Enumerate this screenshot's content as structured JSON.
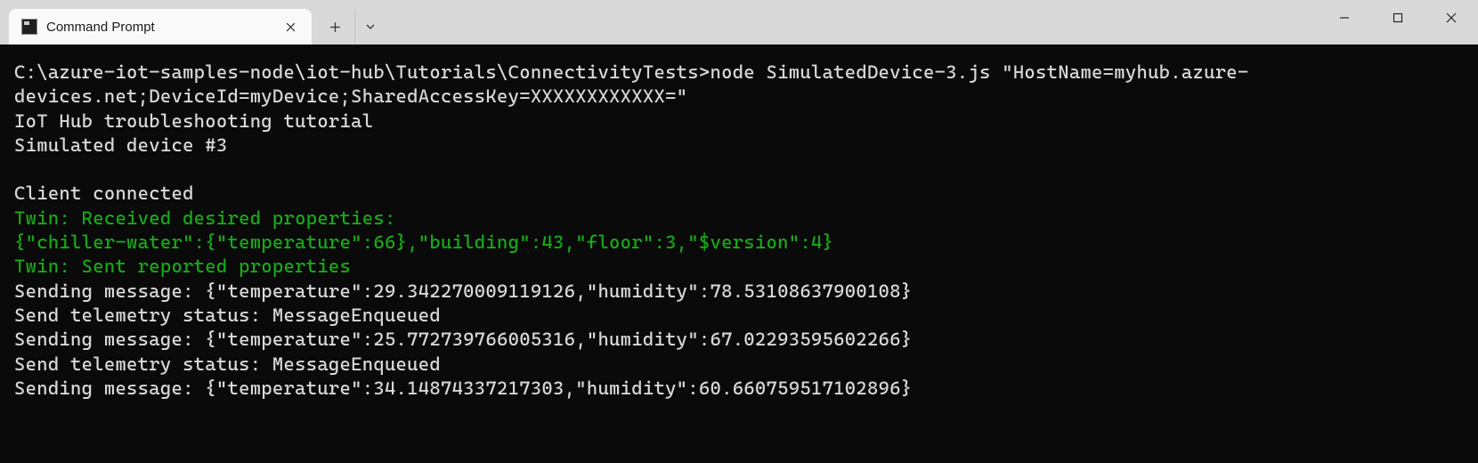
{
  "tab": {
    "title": "Command Prompt"
  },
  "terminal": {
    "lines": [
      {
        "text": "C:\\azure-iot-samples-node\\iot-hub\\Tutorials\\ConnectivityTests>node SimulatedDevice-3.js \"HostName=myhub.azure-devices.net;DeviceId=myDevice;SharedAccessKey=XXXXXXXXXXXX=\"",
        "class": ""
      },
      {
        "text": "IoT Hub troubleshooting tutorial",
        "class": ""
      },
      {
        "text": "Simulated device #3",
        "class": ""
      },
      {
        "text": "",
        "class": ""
      },
      {
        "text": "Client connected",
        "class": ""
      },
      {
        "text": "Twin: Received desired properties:",
        "class": "green"
      },
      {
        "text": "{\"chiller-water\":{\"temperature\":66},\"building\":43,\"floor\":3,\"$version\":4}",
        "class": "green"
      },
      {
        "text": "Twin: Sent reported properties",
        "class": "green"
      },
      {
        "text": "Sending message: {\"temperature\":29.342270009119126,\"humidity\":78.53108637900108}",
        "class": ""
      },
      {
        "text": "Send telemetry status: MessageEnqueued",
        "class": ""
      },
      {
        "text": "Sending message: {\"temperature\":25.772739766005316,\"humidity\":67.02293595602266}",
        "class": ""
      },
      {
        "text": "Send telemetry status: MessageEnqueued",
        "class": ""
      },
      {
        "text": "Sending message: {\"temperature\":34.14874337217303,\"humidity\":60.660759517102896}",
        "class": ""
      }
    ]
  }
}
